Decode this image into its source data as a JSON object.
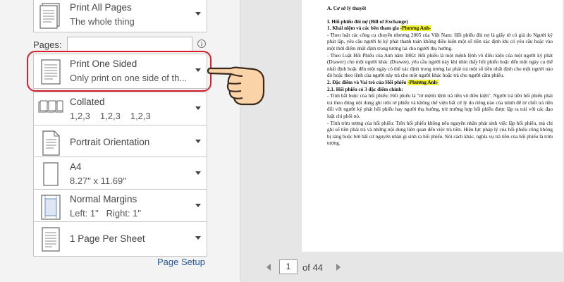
{
  "settings": {
    "print_pages": {
      "title": "Print All Pages",
      "subtitle": "The whole thing",
      "icon": "document-pages-icon"
    },
    "pages": {
      "label": "Pages:",
      "value": "",
      "info": "i"
    },
    "sides": {
      "title": "Print One Sided",
      "subtitle": "Only print on one side of th...",
      "icon": "one-sided-page-icon"
    },
    "collation": {
      "title": "Collated",
      "sequence": [
        "1,2,3",
        "1,2,3",
        "1,2,3"
      ],
      "icon": "collated-pages-icon"
    },
    "orientation": {
      "title": "Portrait Orientation",
      "icon": "portrait-page-icon"
    },
    "paper": {
      "title": "A4",
      "subtitle": "8.27\" x 11.69\"",
      "icon": "paper-size-icon"
    },
    "margins": {
      "title": "Normal Margins",
      "subtitle": "Left: 1\"   Right: 1\"",
      "icon": "margins-icon"
    },
    "per_sheet": {
      "title": "1 Page Per Sheet",
      "icon": "page-per-sheet-icon"
    },
    "page_setup_link": "Page Setup"
  },
  "highlight_color": "#d61f2c",
  "pager": {
    "current": "1",
    "of_label": "of 44"
  },
  "document": {
    "lines": [
      {
        "text": "A. Cơ sở lý thuyết",
        "bold": true
      },
      {
        "gap": true
      },
      {
        "text": "I. Hối phiếu đòi nợ (Bill of Exchange)",
        "bold": true
      },
      {
        "text": "1. Khái niệm và các bên tham gia ",
        "bold": true,
        "hl": "-Phương Anh-"
      },
      {
        "text": "- Theo luật các công cụ chuyển nhượng 2005 của Việt Nam: Hối phiếu đòi nợ là giấy tờ có giá do Người ký phát lập, yêu cầu người bị ký phát thanh toán không điều kiện một số tiền xác định khi có yêu cầu hoặc vào một thời điểm nhất định trong tương lai cho người thụ hưởng."
      },
      {
        "text": "- Theo Luật Hối Phiếu của Anh năm 1882: Hối phiếu là một mệnh lệnh vô điều kiện của một người ký phát (Drawer) cho một người khác (Drawee), yêu cầu người này khi nhìn thấy hối phiếu hoặc đến một ngày cụ thể nhất định hoặc đến một ngày có thể xác định trong tương lai phải trả một số tiền nhất định cho một người nào đó hoặc theo lệnh của người này trả cho một người khác hoặc trả cho người cầm phiếu."
      },
      {
        "text": "2. Đặc điểm và Vai trò của Hối phiếu ",
        "bold": true,
        "hl": "-Phương Anh-"
      },
      {
        "text": "   2.1. Hối phiếu có 3 đặc điểm chính:",
        "bold": true
      },
      {
        "text": "- Tính bắt buộc của hối phiếu: Hối phiếu là \"tờ mệnh lệnh trả tiền vô điều kiện\". Người trả tiền hối phiếu phải trả theo đúng nội dung ghi trên tờ phiếu và không thể viện bất cứ lý do riêng nào của mình để từ chối trả tiền đối với người ký phát hối phiếu hay người thụ hưởng, trừ trường hợp hối phiếu được lập ra trái với các đạo luật chi phối nó."
      },
      {
        "text": "- Tính trừu tượng của hối phiếu: Trên hối phiếu không nêu nguyên nhân phát sinh việc lập hối phiếu, mà chỉ ghi số tiền phải trả và những nội dung liên quan đến việc trả tiền. Hiệu lực pháp lý của hối phiếu cũng không bị ràng buộc bởi bất cứ nguyên nhân gì sinh ra hối phiếu. Nói cách khác, nghĩa vụ trả tiền của hối phiếu là trừu tượng."
      }
    ]
  }
}
